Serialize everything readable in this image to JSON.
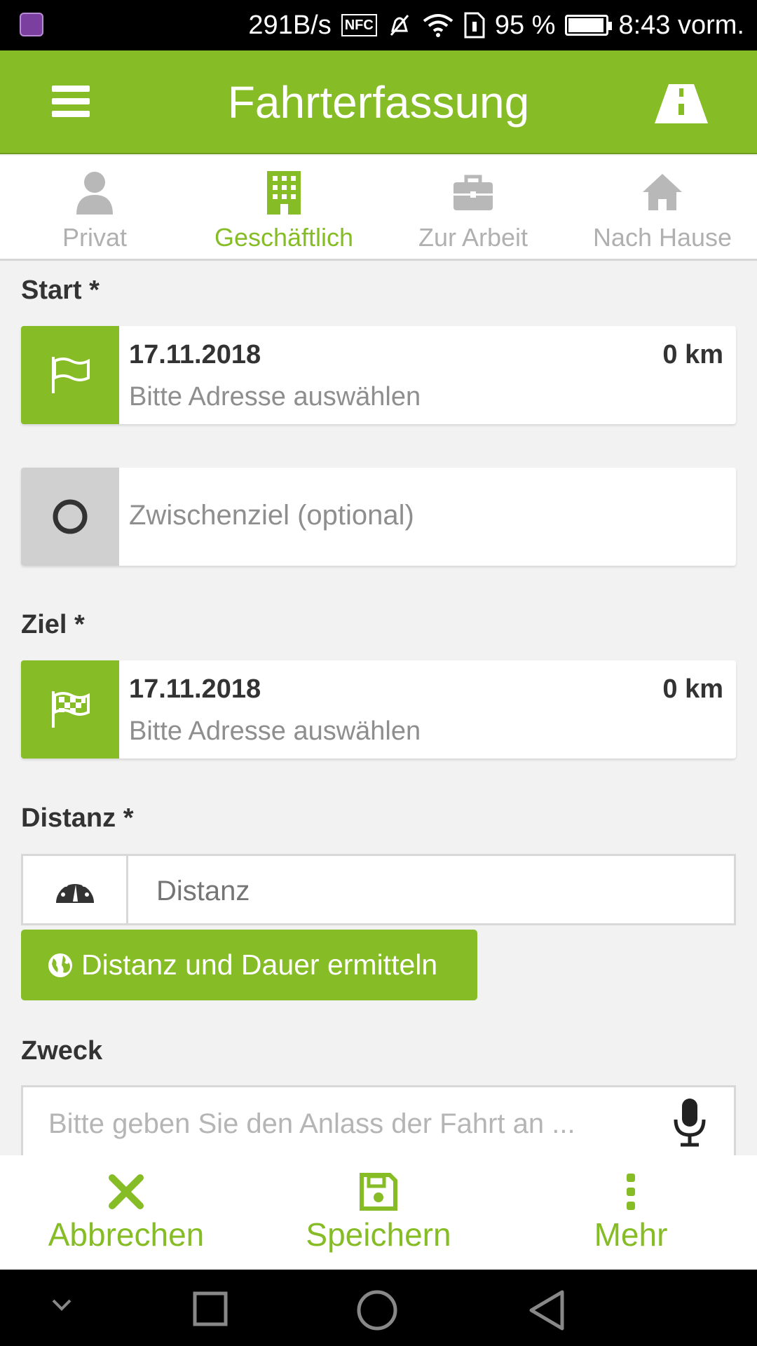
{
  "status_bar": {
    "speed": "291B/s",
    "nfc": "NFC",
    "battery": "95 %",
    "battery_level": 0.95,
    "time": "8:43 vorm."
  },
  "header": {
    "title": "Fahrterfassung",
    "menu_icon": "hamburger-icon",
    "action_icon": "road-icon"
  },
  "tabs": [
    {
      "label": "Privat",
      "icon": "person-icon",
      "active": false
    },
    {
      "label": "Geschäftlich",
      "icon": "building-icon",
      "active": true
    },
    {
      "label": "Zur Arbeit",
      "icon": "briefcase-icon",
      "active": false
    },
    {
      "label": "Nach Hause",
      "icon": "home-icon",
      "active": false
    }
  ],
  "start": {
    "label": "Start *",
    "date": "17.11.2018",
    "km": "0 km",
    "address": "Bitte Adresse auswählen"
  },
  "waypoint": {
    "placeholder": "Zwischenziel (optional)"
  },
  "ziel": {
    "label": "Ziel *",
    "date": "17.11.2018",
    "km": "0 km",
    "address": "Bitte Adresse auswählen"
  },
  "distanz": {
    "label": "Distanz *",
    "placeholder": "Distanz",
    "button": "Distanz und Dauer ermitteln"
  },
  "zweck": {
    "label": "Zweck",
    "placeholder": "Bitte geben Sie den Anlass der Fahrt an ..."
  },
  "bottom": {
    "cancel": "Abbrechen",
    "save": "Speichern",
    "more": "Mehr"
  },
  "colors": {
    "accent": "#86bc25",
    "text": "#333333",
    "muted": "#8e8e8e"
  }
}
